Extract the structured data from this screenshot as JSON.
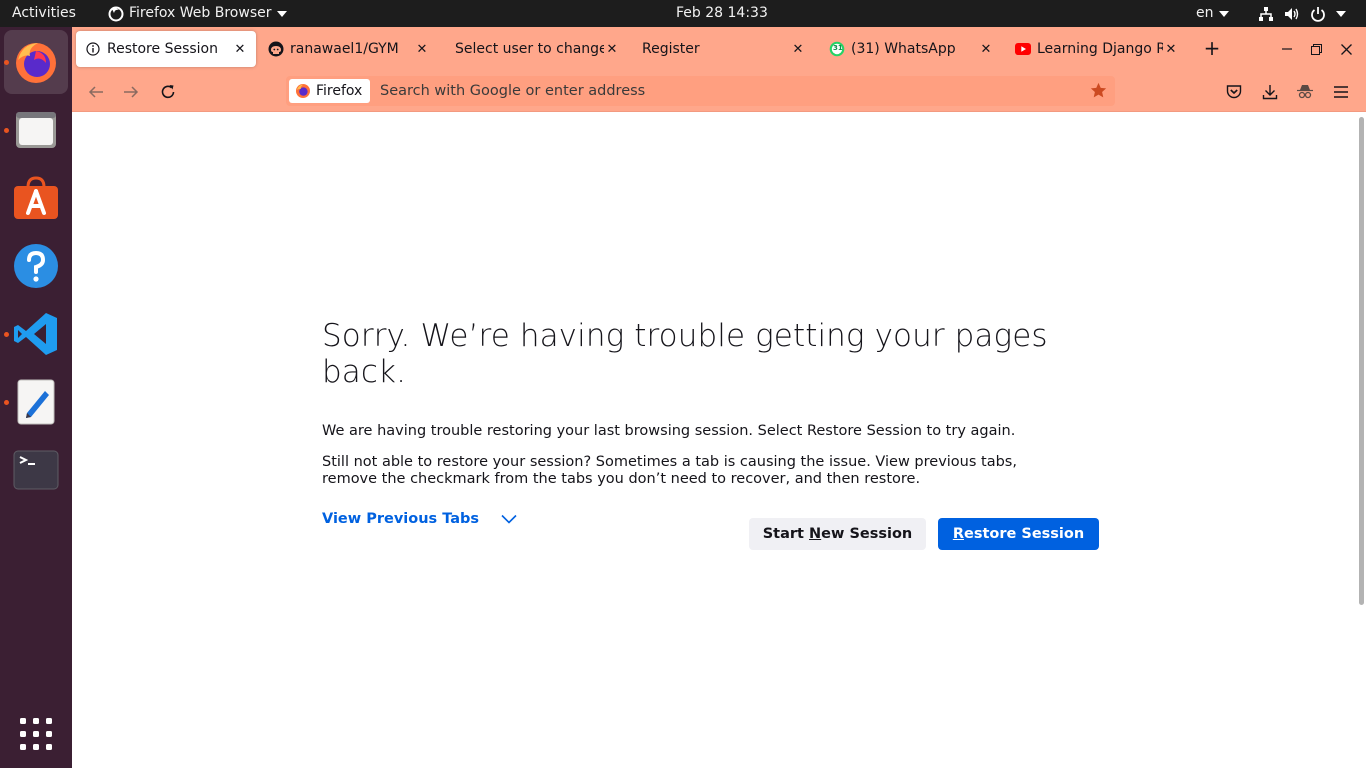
{
  "topbar": {
    "activities": "Activities",
    "app_menu": "Firefox Web Browser",
    "clock": "Feb 28  14:33",
    "language": "en"
  },
  "dock": {
    "items": [
      {
        "name": "firefox",
        "running": true,
        "active": true
      },
      {
        "name": "files",
        "running": true
      },
      {
        "name": "ubuntu-software",
        "running": false
      },
      {
        "name": "help",
        "running": false
      },
      {
        "name": "vscode",
        "running": true
      },
      {
        "name": "text-editor",
        "running": true
      },
      {
        "name": "terminal",
        "running": false
      }
    ]
  },
  "tabs": [
    {
      "title": "Restore Session",
      "icon": "info-icon",
      "selected": true
    },
    {
      "title": "ranawael1/GYM",
      "icon": "github-icon"
    },
    {
      "title": "Select user to change | Django site admin",
      "icon": "none"
    },
    {
      "title": "Register",
      "icon": "none"
    },
    {
      "title": "(31) WhatsApp",
      "icon": "whatsapp-icon",
      "badge": "31"
    },
    {
      "title": "Learning Django REST Framework",
      "icon": "youtube-icon"
    }
  ],
  "navbar": {
    "identity_label": "Firefox",
    "url_placeholder": "Search with Google or enter address"
  },
  "restore": {
    "title": "Sorry. We’re having trouble getting your pages back.",
    "p1": "We are having trouble restoring your last browsing session. Select Restore Session to try again.",
    "p2": "Still not able to restore your session? Sometimes a tab is causing the issue. View previous tabs, remove the checkmark from the tabs you don’t need to recover, and then restore.",
    "view_previous_tabs": "View Previous Tabs",
    "start_new_session": {
      "before": "Start ",
      "accesskey": "N",
      "after": "ew Session"
    },
    "restore_session": {
      "before": "",
      "accesskey": "R",
      "after": "estore Session"
    }
  },
  "colors": {
    "tab_bar": "#ffa78b",
    "accent_blue": "#0061e0",
    "ubuntu_orange": "#e95420",
    "dock_bg": "#3b1f33",
    "topbar_bg": "#1d1d1d"
  }
}
